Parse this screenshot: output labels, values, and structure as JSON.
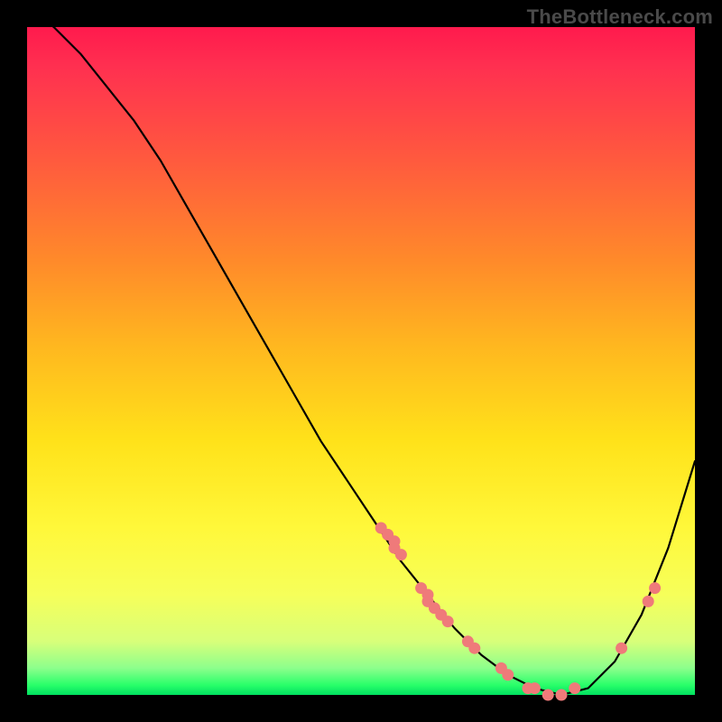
{
  "attribution": "TheBottleneck.com",
  "colors": {
    "curve": "#000000",
    "points": "#ef7a7a",
    "gradient_top": "#ff1a4d",
    "gradient_bottom": "#00e060",
    "background": "#000000"
  },
  "chart_data": {
    "type": "line",
    "title": "",
    "xlabel": "",
    "ylabel": "",
    "xlim": [
      0,
      100
    ],
    "ylim": [
      0,
      100
    ],
    "grid": false,
    "legend": false,
    "series": [
      {
        "name": "bottleneck-curve",
        "x": [
          0,
          4,
          8,
          12,
          16,
          20,
          24,
          28,
          32,
          36,
          40,
          44,
          48,
          52,
          56,
          60,
          64,
          68,
          72,
          76,
          80,
          84,
          88,
          92,
          96,
          100
        ],
        "y": [
          103,
          100,
          96,
          91,
          86,
          80,
          73,
          66,
          59,
          52,
          45,
          38,
          32,
          26,
          20,
          15,
          10,
          6,
          3,
          1,
          0,
          1,
          5,
          12,
          22,
          35
        ]
      }
    ],
    "scatter_points": {
      "name": "highlighted-points",
      "x": [
        53,
        54,
        55,
        55,
        56,
        59,
        60,
        60,
        61,
        62,
        63,
        66,
        67,
        71,
        72,
        75,
        76,
        78,
        80,
        82,
        89,
        93,
        94
      ],
      "y": [
        25,
        24,
        23,
        22,
        21,
        16,
        15,
        14,
        13,
        12,
        11,
        8,
        7,
        4,
        3,
        1,
        1,
        0,
        0,
        1,
        7,
        14,
        16
      ]
    }
  }
}
